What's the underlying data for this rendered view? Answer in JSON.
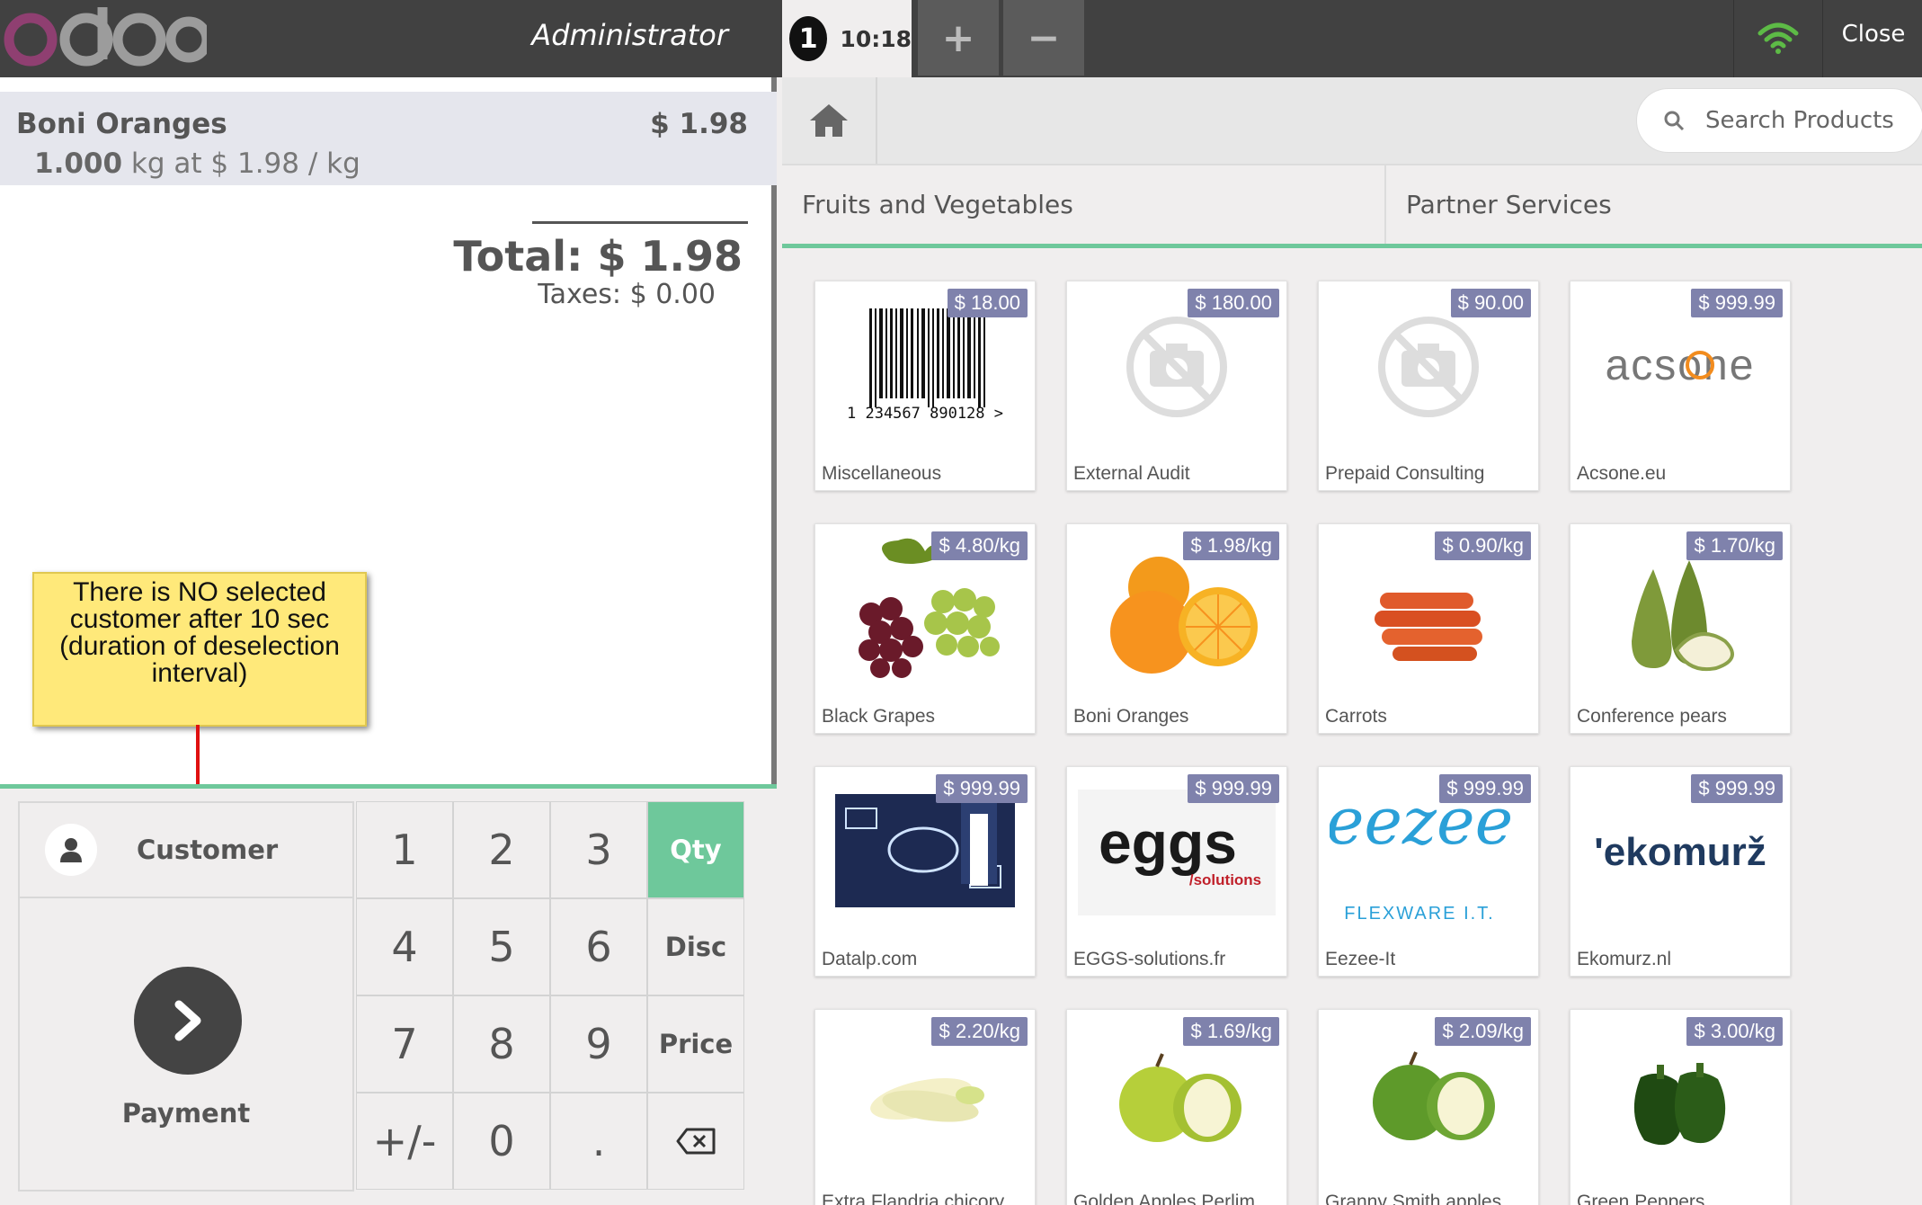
{
  "app": {
    "logo_text": "odoo",
    "user": "Administrator",
    "order_number": "1",
    "order_time": "10:18",
    "add_order_symbol": "+",
    "remove_order_symbol": "−",
    "close_label": "Close",
    "colors": {
      "topbar": "#414141",
      "accent": "#6ec89b",
      "price_badge": "#7f82ac",
      "wifi": "#5dbb46"
    }
  },
  "order": {
    "line": {
      "name": "Boni Oranges",
      "price": "$ 1.98",
      "qty": "1.000",
      "unit_text": " kg at $ 1.98 / kg"
    },
    "total": "Total: $ 1.98",
    "taxes": "Taxes: $ 0.00"
  },
  "callout": {
    "text": "There is NO selected customer after 10 sec (duration of deselection interval)"
  },
  "actionpad": {
    "customer_label": "Customer",
    "payment_label": "Payment"
  },
  "numpad": {
    "keys": [
      "1",
      "2",
      "3",
      "Qty",
      "4",
      "5",
      "6",
      "Disc",
      "7",
      "8",
      "9",
      "Price",
      "+/-",
      "0",
      ".",
      "backspace-icon"
    ],
    "active_mode": "Qty"
  },
  "products_screen": {
    "search_placeholder": "Search Products",
    "categories": [
      "Fruits and Vegetables",
      "Partner Services"
    ],
    "products": [
      {
        "name": "Miscellaneous",
        "price": "$ 18.00",
        "image": "barcode"
      },
      {
        "name": "External Audit",
        "price": "$ 180.00",
        "image": "no-image"
      },
      {
        "name": "Prepaid Consulting",
        "price": "$ 90.00",
        "image": "no-image"
      },
      {
        "name": "Acsone.eu",
        "price": "$ 999.99",
        "image": "acsone-logo"
      },
      {
        "name": "Black Grapes",
        "price": "$ 4.80/kg",
        "image": "grapes"
      },
      {
        "name": "Boni Oranges",
        "price": "$ 1.98/kg",
        "image": "oranges"
      },
      {
        "name": "Carrots",
        "price": "$ 0.90/kg",
        "image": "carrots"
      },
      {
        "name": "Conference pears",
        "price": "$ 1.70/kg",
        "image": "pears"
      },
      {
        "name": "Datalp.com",
        "price": "$ 999.99",
        "image": "datalp-logo"
      },
      {
        "name": "EGGS-solutions.fr",
        "price": "$ 999.99",
        "image": "eggs-logo"
      },
      {
        "name": "Eezee-It",
        "price": "$ 999.99",
        "image": "eezee-logo"
      },
      {
        "name": "Ekomurz.nl",
        "price": "$ 999.99",
        "image": "ekomurz-logo"
      },
      {
        "name": "Extra Flandria chicory",
        "price": "$ 2.20/kg",
        "image": "chicory"
      },
      {
        "name": "Golden Apples Perlim",
        "price": "$ 1.69/kg",
        "image": "golden-apples"
      },
      {
        "name": "Granny Smith apples",
        "price": "$ 2.09/kg",
        "image": "granny-apples"
      },
      {
        "name": "Green Peppers",
        "price": "$ 3.00/kg",
        "image": "green-peppers"
      }
    ],
    "image_text": {
      "barcode_digits": "1  234567  890128  >",
      "acsone": "acsone",
      "eggs": "eggs",
      "eggs_sub": "/solutions",
      "eezee": "eezee",
      "eezee_sub": "FLEXWARE I.T.",
      "ekomurz": "'ekomurž"
    }
  }
}
